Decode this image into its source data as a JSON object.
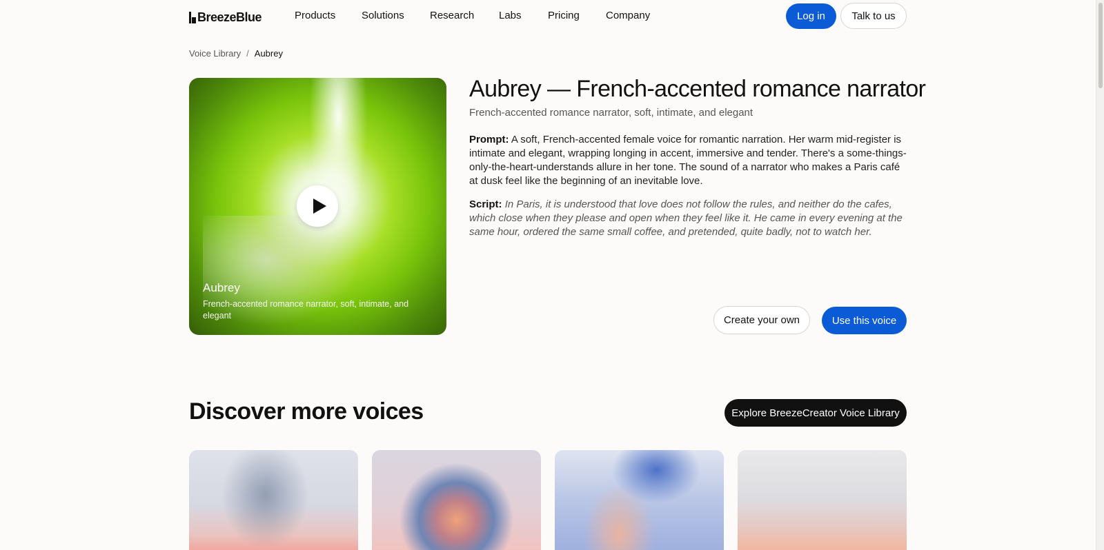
{
  "header": {
    "logo_text": "BreezeBlue",
    "nav": [
      "Products",
      "Solutions",
      "Research",
      "Labs",
      "Pricing",
      "Company"
    ],
    "login_label": "Log in",
    "talk_label": "Talk to us"
  },
  "breadcrumb": {
    "parent": "Voice Library",
    "separator": "/",
    "current": "Aubrey"
  },
  "hero": {
    "name": "Aubrey",
    "subtitle": "French-accented romance narrator, soft, intimate, and elegant"
  },
  "voice": {
    "title": "Aubrey — French-accented romance narrator",
    "subtitle": "French-accented romance narrator, soft, intimate, and elegant",
    "prompt_label": "Prompt:",
    "prompt_text": "A soft, French-accented female voice for romantic narration. Her warm mid-register is intimate and elegant, wrapping longing in accent, immersive and tender. There's a some-things-only-the-heart-understands allure in her tone. The sound of a narrator who makes a Paris café at dusk feel like the beginning of an inevitable love.",
    "script_label": "Script:",
    "script_text": "In Paris, it is understood that love does not follow the rules, and neither do the cafes, which close when they please and open when they feel like it. He came in every evening at the same hour, ordered the same small coffee, and pretended, quite badly, not to watch her.",
    "create_label": "Create your own",
    "use_label": "Use this voice"
  },
  "discover": {
    "title": "Discover more voices",
    "explore_label": "Explore BreezeCreator Voice Library"
  },
  "colors": {
    "accent": "#0b5ad6",
    "background": "#fcfbfa",
    "dark_button": "#111111"
  }
}
